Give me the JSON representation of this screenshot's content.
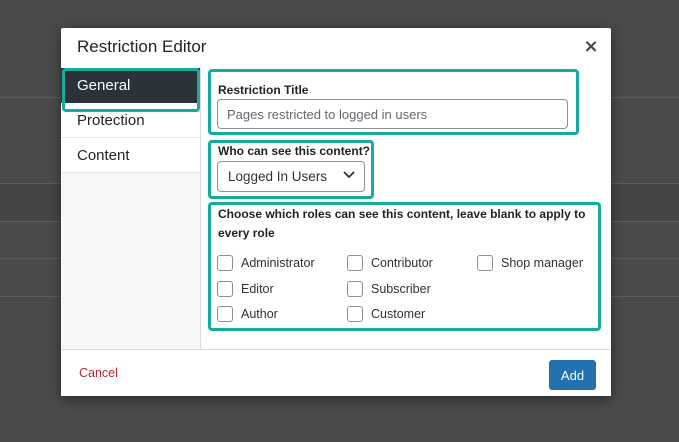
{
  "modal": {
    "title": "Restriction Editor",
    "close_label": "×"
  },
  "tabs": [
    {
      "label": "General",
      "active": true
    },
    {
      "label": "Protection",
      "active": false
    },
    {
      "label": "Content",
      "active": false
    }
  ],
  "general": {
    "title_field": {
      "label": "Restriction Title",
      "value": "",
      "placeholder": "Pages restricted to logged in users"
    },
    "visibility_field": {
      "label": "Who can see this content?",
      "selected": "Logged In Users"
    },
    "roles_field": {
      "label": "Choose which roles can see this content, leave blank to apply to every role",
      "roles": [
        {
          "label": "Administrator",
          "checked": false
        },
        {
          "label": "Editor",
          "checked": false
        },
        {
          "label": "Author",
          "checked": false
        },
        {
          "label": "Contributor",
          "checked": false
        },
        {
          "label": "Subscriber",
          "checked": false
        },
        {
          "label": "Customer",
          "checked": false
        },
        {
          "label": "Shop manager",
          "checked": false
        }
      ]
    }
  },
  "footer": {
    "cancel_label": "Cancel",
    "add_label": "Add"
  },
  "colors": {
    "highlight": "#17ab9f",
    "primary_button": "#2271b1",
    "cancel_link": "#b32d2e",
    "active_tab": "#2c3338"
  }
}
